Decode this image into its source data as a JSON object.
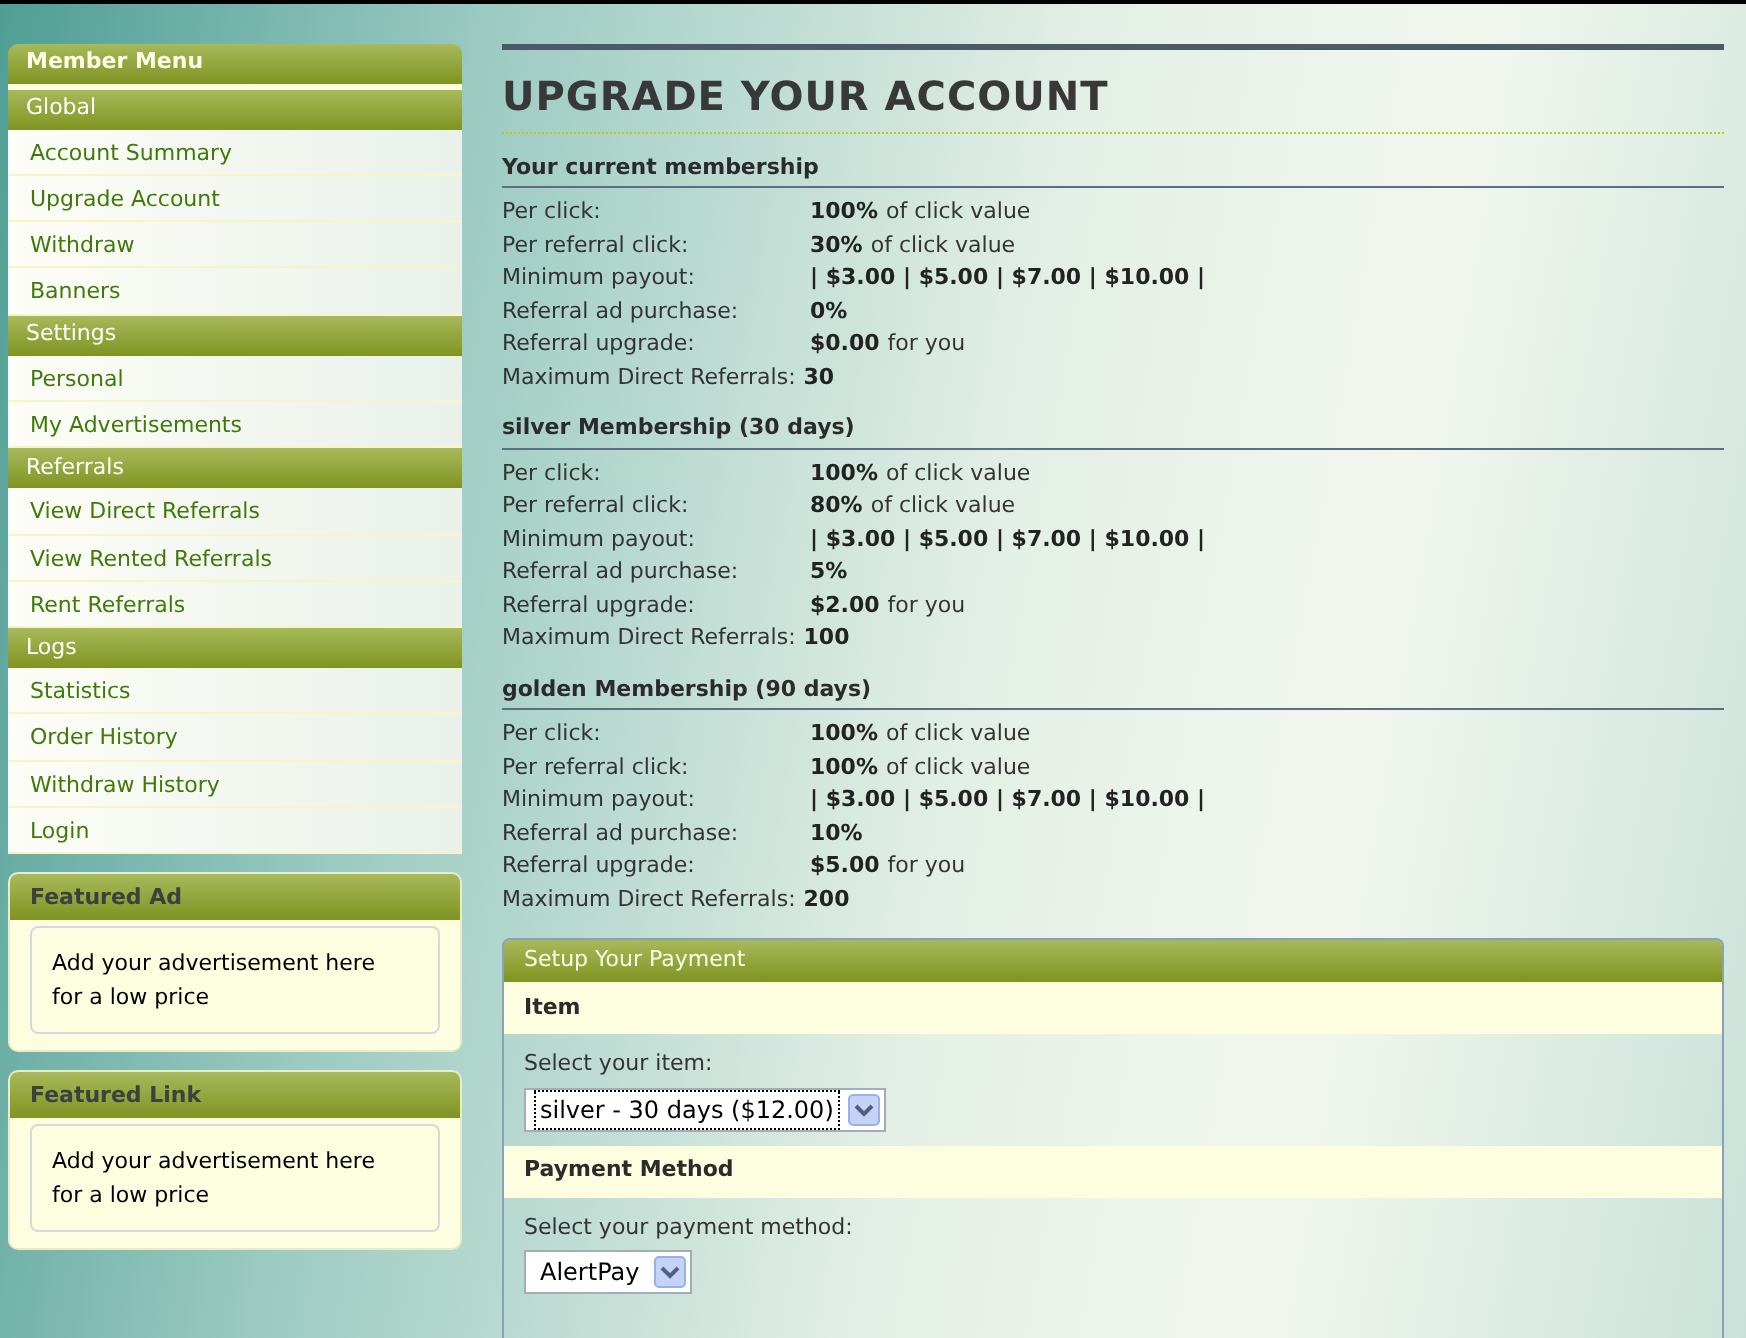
{
  "sidebar": {
    "title": "Member Menu",
    "groups": [
      {
        "heading": "Global",
        "items": [
          "Account Summary",
          "Upgrade Account",
          "Withdraw",
          "Banners"
        ]
      },
      {
        "heading": "Settings",
        "items": [
          "Personal",
          "My Advertisements"
        ]
      },
      {
        "heading": "Referrals",
        "items": [
          "View Direct Referrals",
          "View Rented Referrals",
          "Rent Referrals"
        ]
      },
      {
        "heading": "Logs",
        "items": [
          "Statistics",
          "Order History",
          "Withdraw History",
          "Login"
        ]
      }
    ],
    "boxes": [
      {
        "title": "Featured Ad",
        "text": "Add your advertisement here for a low price"
      },
      {
        "title": "Featured Link",
        "text": "Add your advertisement here for a low price"
      }
    ]
  },
  "main": {
    "title": "UPGRADE YOUR ACCOUNT",
    "memberships": [
      {
        "heading": "Your current membership",
        "rows": [
          {
            "label": "Per click:",
            "value": "100%",
            "note": "of click value"
          },
          {
            "label": "Per referral click:",
            "value": "30%",
            "note": "of click value"
          },
          {
            "label": "Minimum payout:",
            "value": "| $3.00 | $5.00 | $7.00 | $10.00 |"
          },
          {
            "label": "Referral ad purchase:",
            "value": "0%"
          },
          {
            "label": "Referral upgrade:",
            "value": "$0.00",
            "note": "for you"
          },
          {
            "label": "Maximum Direct Referrals:",
            "value": "30",
            "inline": true
          }
        ]
      },
      {
        "heading": "silver Membership (30 days)",
        "rows": [
          {
            "label": "Per click:",
            "value": "100%",
            "note": "of click value"
          },
          {
            "label": "Per referral click:",
            "value": "80%",
            "note": "of click value"
          },
          {
            "label": "Minimum payout:",
            "value": "| $3.00 | $5.00 | $7.00 | $10.00 |"
          },
          {
            "label": "Referral ad purchase:",
            "value": "5%"
          },
          {
            "label": "Referral upgrade:",
            "value": "$2.00",
            "note": "for you"
          },
          {
            "label": "Maximum Direct Referrals:",
            "value": "100",
            "inline": true
          }
        ]
      },
      {
        "heading": "golden Membership (90 days)",
        "rows": [
          {
            "label": "Per click:",
            "value": "100%",
            "note": "of click value"
          },
          {
            "label": "Per referral click:",
            "value": "100%",
            "note": "of click value"
          },
          {
            "label": "Minimum payout:",
            "value": "| $3.00 | $5.00 | $7.00 | $10.00 |"
          },
          {
            "label": "Referral ad purchase:",
            "value": "10%"
          },
          {
            "label": "Referral upgrade:",
            "value": "$5.00",
            "note": "for you"
          },
          {
            "label": "Maximum Direct Referrals:",
            "value": "200",
            "inline": true
          }
        ]
      }
    ],
    "payment": {
      "title": "Setup Your Payment",
      "sections": [
        {
          "heading": "Item",
          "label": "Select your item:",
          "value": "silver - 30 days ($12.00)"
        },
        {
          "heading": "Payment Method",
          "label": "Select your payment method:",
          "value": "AlertPay"
        }
      ]
    }
  }
}
